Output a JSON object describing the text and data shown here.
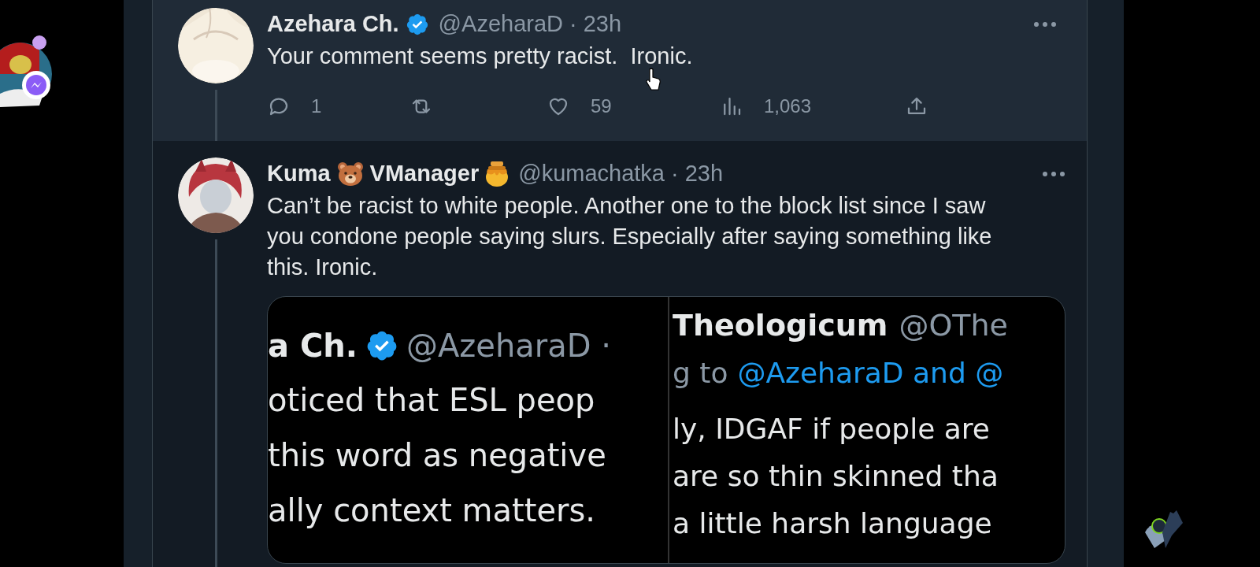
{
  "tweets": [
    {
      "hovered": true,
      "name_parts": [
        {
          "kind": "text",
          "text": "Azehara Ch."
        }
      ],
      "verified": true,
      "handle": "@AzeharaD",
      "time": "· 23h",
      "text": "Your comment seems pretty racist.  Ironic.",
      "actions": [
        {
          "kind": "reply",
          "count": "1"
        },
        {
          "kind": "retweet"
        },
        {
          "kind": "like",
          "count": "59"
        },
        {
          "kind": "views",
          "count": "1,063"
        },
        {
          "kind": "share"
        }
      ]
    },
    {
      "hovered": false,
      "name_parts": [
        {
          "kind": "text",
          "text": "Kuma"
        },
        {
          "kind": "bear"
        },
        {
          "kind": "text",
          "text": "VManager"
        },
        {
          "kind": "honey"
        }
      ],
      "verified": false,
      "handle": "@kumachatka",
      "time": "· 23h",
      "text": "Can’t be racist to white people. Another one to the block list since I saw you condone people saying slurs. Especially after saying something like this. Ironic.",
      "media": {
        "left": {
          "name": "a Ch.",
          "verified": true,
          "handle": "@AzeharaD ·",
          "lines": [
            "oticed that ESL peop",
            "this word as negative",
            "ally context matters."
          ]
        },
        "right": {
          "name": "Theologicum",
          "handle": "@OThe",
          "reply_prefix": "g to",
          "reply_mentions": "@AzeharaD and @",
          "lines": [
            "ly, IDGAF if people are",
            "are so thin skinned tha",
            "a little harsh language"
          ]
        }
      }
    }
  ]
}
